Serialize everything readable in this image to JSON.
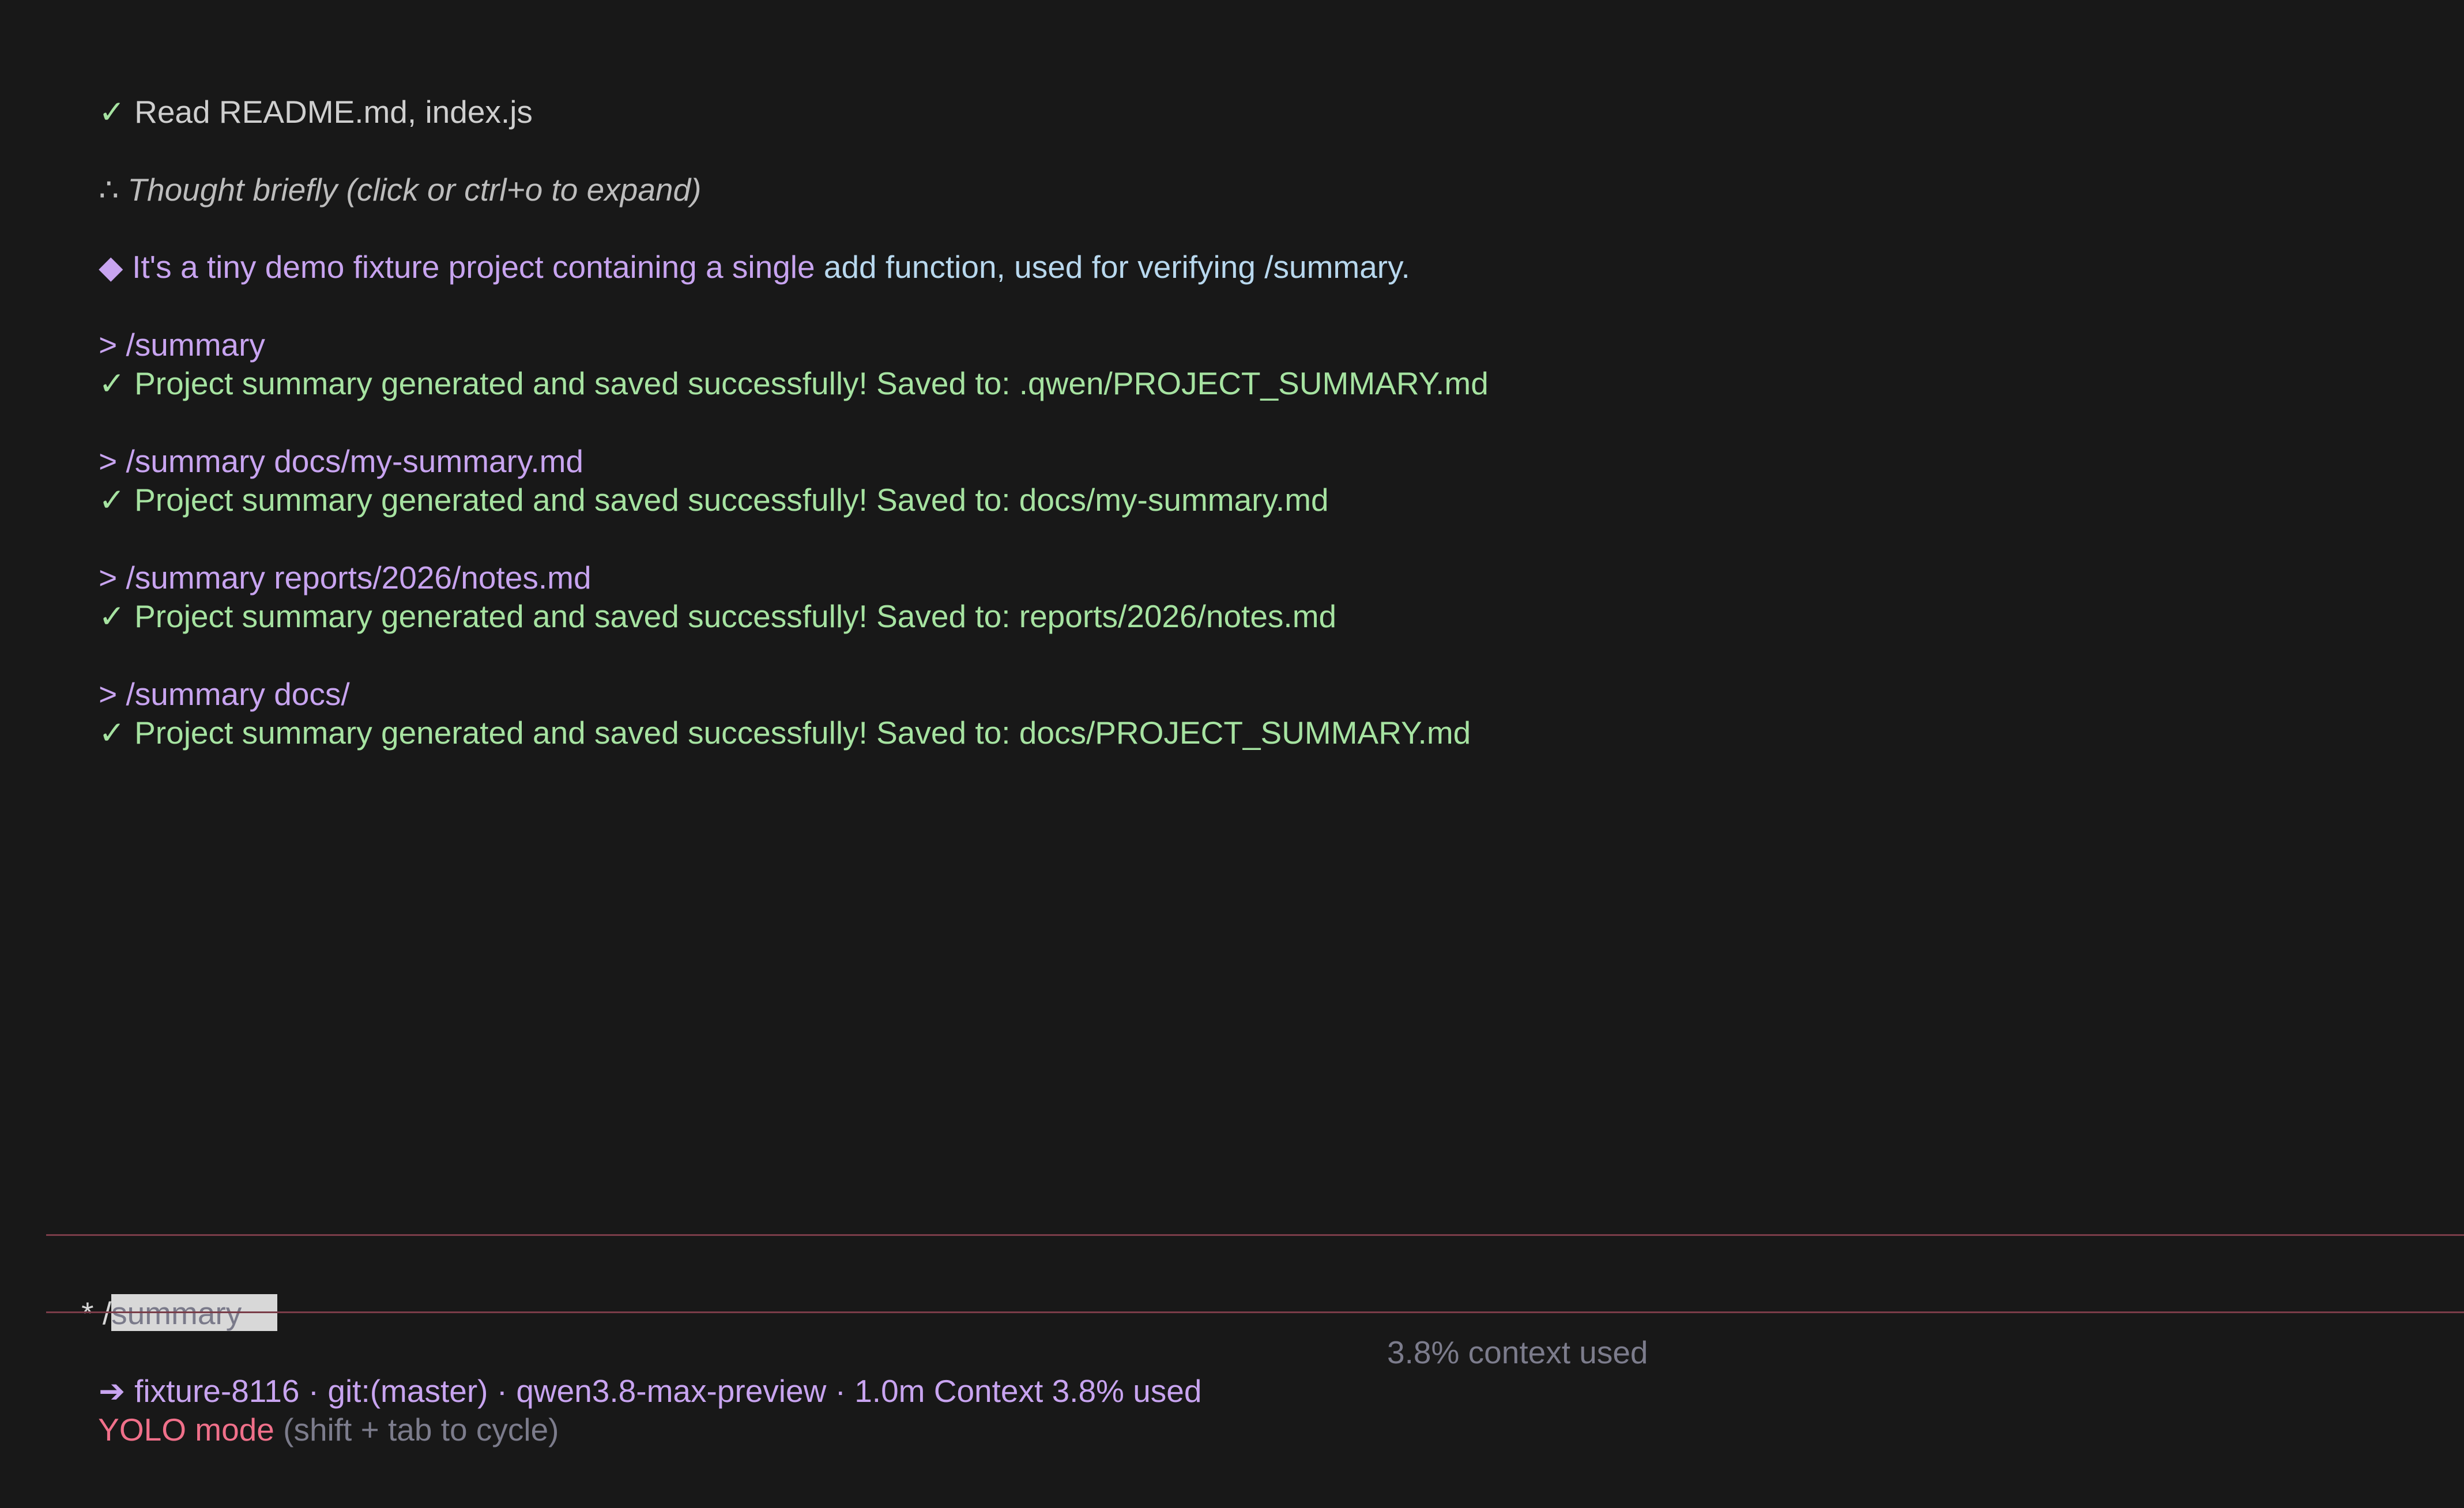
{
  "transcript": {
    "read_line": {
      "icon": "✓",
      "text": "Read README.md, index.js"
    },
    "thought_line": {
      "icon": "∴",
      "text": "Thought briefly (click or ctrl+o to expand)"
    },
    "answer_line": {
      "icon": "◆",
      "text_part1": "It's a tiny demo fixture project containing a single",
      "text_part2": " add function, used for verifying /summary."
    },
    "commands": [
      {
        "command": "> /summary",
        "result_icon": "✓",
        "result": "Project summary generated and saved successfully! Saved to: .qwen/PROJECT_SUMMARY.md"
      },
      {
        "command": "> /summary docs/my-summary.md",
        "result_icon": "✓",
        "result": "Project summary generated and saved successfully! Saved to: docs/my-summary.md"
      },
      {
        "command": "> /summary reports/2026/notes.md",
        "result_icon": "✓",
        "result": "Project summary generated and saved successfully! Saved to: reports/2026/notes.md"
      },
      {
        "command": "> /summary docs/",
        "result_icon": "✓",
        "result": "Project summary generated and saved successfully! Saved to: docs/PROJECT_SUMMARY.md"
      }
    ]
  },
  "prompt": {
    "marker": "* ",
    "typed": "/",
    "suggestion": "summary"
  },
  "status": {
    "icon": "➔",
    "info": "fixture-8116 · git:(master) · qwen3.8-max-preview · 1.0m Context 3.8% used",
    "context_right": "3.8% context used",
    "mode": "YOLO mode",
    "mode_hint": " (shift + tab to cycle)"
  },
  "colors": {
    "background": "#181818",
    "success": "#a6e3a1",
    "command": "#c8a4f0",
    "answer_secondary": "#b8d8ee",
    "divider": "#7a3c48",
    "yolo": "#f0708a",
    "muted": "#7c7c8c"
  }
}
